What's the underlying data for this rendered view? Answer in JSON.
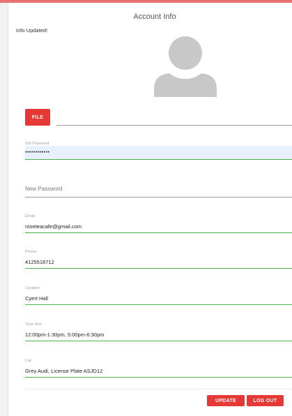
{
  "page": {
    "title": "Account Info",
    "status_message": "Info Updated!"
  },
  "avatar": {
    "icon": "user-silhouette-icon",
    "color": "#c8c8c8"
  },
  "file": {
    "label": "FILE"
  },
  "fields": {
    "old_password": {
      "label": "Old Password",
      "value": "••••••••••••"
    },
    "new_password": {
      "placeholder": "New Password"
    },
    "email": {
      "label": "Email:",
      "value": "roseteacafe@gmail.com"
    },
    "phone": {
      "label": "Phone:",
      "value": "4125518712"
    },
    "location": {
      "label": "Location:",
      "value": "Cyert Hall"
    },
    "time_slot": {
      "label": "Time Slot:",
      "value": "12:00pm-1:30pm, 5:00pm-6:30pm"
    },
    "car": {
      "label": "Car:",
      "value": "Grey Audi, License Plate ASJD12"
    }
  },
  "actions": {
    "update_label": "UPDATE",
    "logout_label": "LOG OUT"
  },
  "colors": {
    "accent": "#e53935",
    "focus_line": "#4caf50",
    "topbar": "#e57373"
  }
}
